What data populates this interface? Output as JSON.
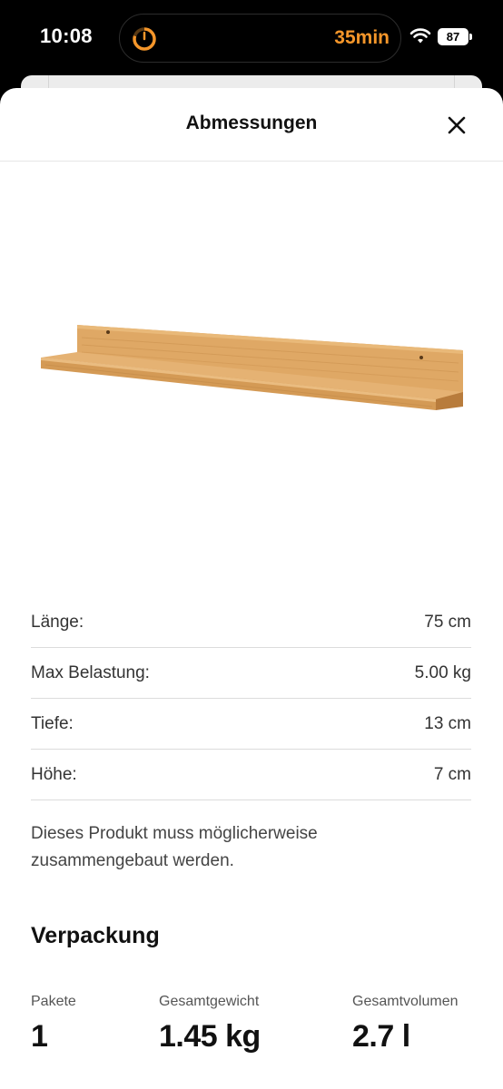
{
  "status_bar": {
    "time": "10:08",
    "timer": "35min",
    "battery": "87"
  },
  "sheet": {
    "title": "Abmessungen"
  },
  "dimensions": [
    {
      "label": "Länge:",
      "value": "75 cm"
    },
    {
      "label": "Max Belastung:",
      "value": "5.00 kg"
    },
    {
      "label": "Tiefe:",
      "value": "13 cm"
    },
    {
      "label": "Höhe:",
      "value": "7 cm"
    }
  ],
  "note": "Dieses Produkt muss möglicherweise zusammengebaut werden.",
  "packaging": {
    "title": "Verpackung",
    "columns": [
      {
        "label": "Pakete",
        "value": "1"
      },
      {
        "label": "Gesamtgewicht",
        "value": "1.45 kg"
      },
      {
        "label": "Gesamtvolumen",
        "value": "2.7 l"
      }
    ]
  },
  "colors": {
    "timer_accent": "#f5962a",
    "wood": "#d9a05b"
  }
}
